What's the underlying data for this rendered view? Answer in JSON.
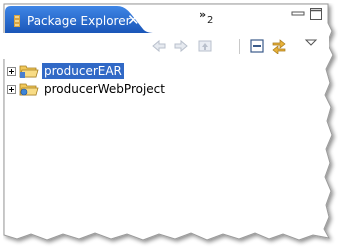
{
  "view": {
    "tab_title": "Package Explorer",
    "overflow_count": "2",
    "accent_color": "#1f5fc0"
  },
  "toolbar": {
    "buttons": [
      "back-icon",
      "forward-icon",
      "up-icon",
      "collapse-all-icon",
      "link-with-editor-icon",
      "view-menu-icon"
    ]
  },
  "tree": {
    "items": [
      {
        "label": "producerEAR",
        "selected": true,
        "expanded": false
      },
      {
        "label": "producerWebProject",
        "selected": false,
        "expanded": false
      }
    ]
  }
}
